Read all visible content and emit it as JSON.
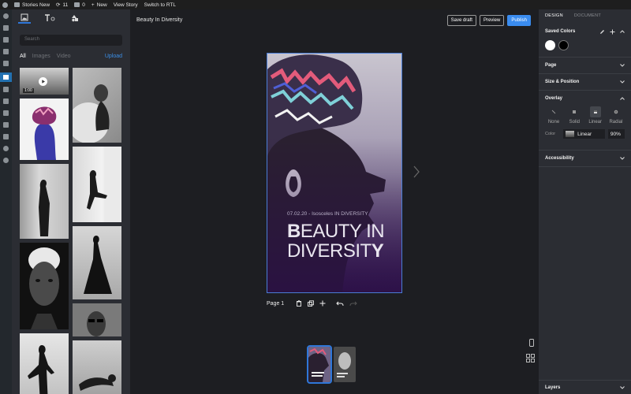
{
  "wp_admin_bar": {
    "site_name": "Stories New",
    "updates_count": "11",
    "comments_count": "0",
    "new_label": "New",
    "view_story_label": "View Story",
    "rtl_label": "Switch to RTL"
  },
  "library": {
    "search_placeholder": "Search",
    "filters": [
      "All",
      "Images",
      "Video"
    ],
    "upload_label": "Upload",
    "video_duration": "1:00"
  },
  "editor": {
    "story_title": "Beauty In Diversity",
    "save_draft_label": "Save draft",
    "preview_label": "Preview",
    "publish_label": "Publish",
    "page_label": "Page 1"
  },
  "story_page": {
    "date_line": "07.02.20 - Isosceles IN DIVERSITY",
    "headline_line1_bold": "B",
    "headline_line1_rest": "EAUTY IN",
    "headline_line2_rest": "DIVERSIT",
    "headline_line2_bold": "Y"
  },
  "design_panel": {
    "tabs": [
      "DESIGN",
      "DOCUMENT"
    ],
    "saved_colors_label": "Saved Colors",
    "saved_colors": [
      "#ffffff",
      "#000000"
    ],
    "page_label": "Page",
    "size_position_label": "Size & Position",
    "overlay_label": "Overlay",
    "overlay_options": [
      "None",
      "Solid",
      "Linear",
      "Radial"
    ],
    "overlay_selected": "Linear",
    "color_label": "Color",
    "color_value": "Linear",
    "opacity_value": "90%",
    "accessibility_label": "Accessibility",
    "layers_label": "Layers"
  },
  "colors": {
    "accent": "#3a8cf0",
    "selection": "#4a7dd6",
    "panel": "#2b2d33",
    "canvas": "#1d1e22"
  }
}
